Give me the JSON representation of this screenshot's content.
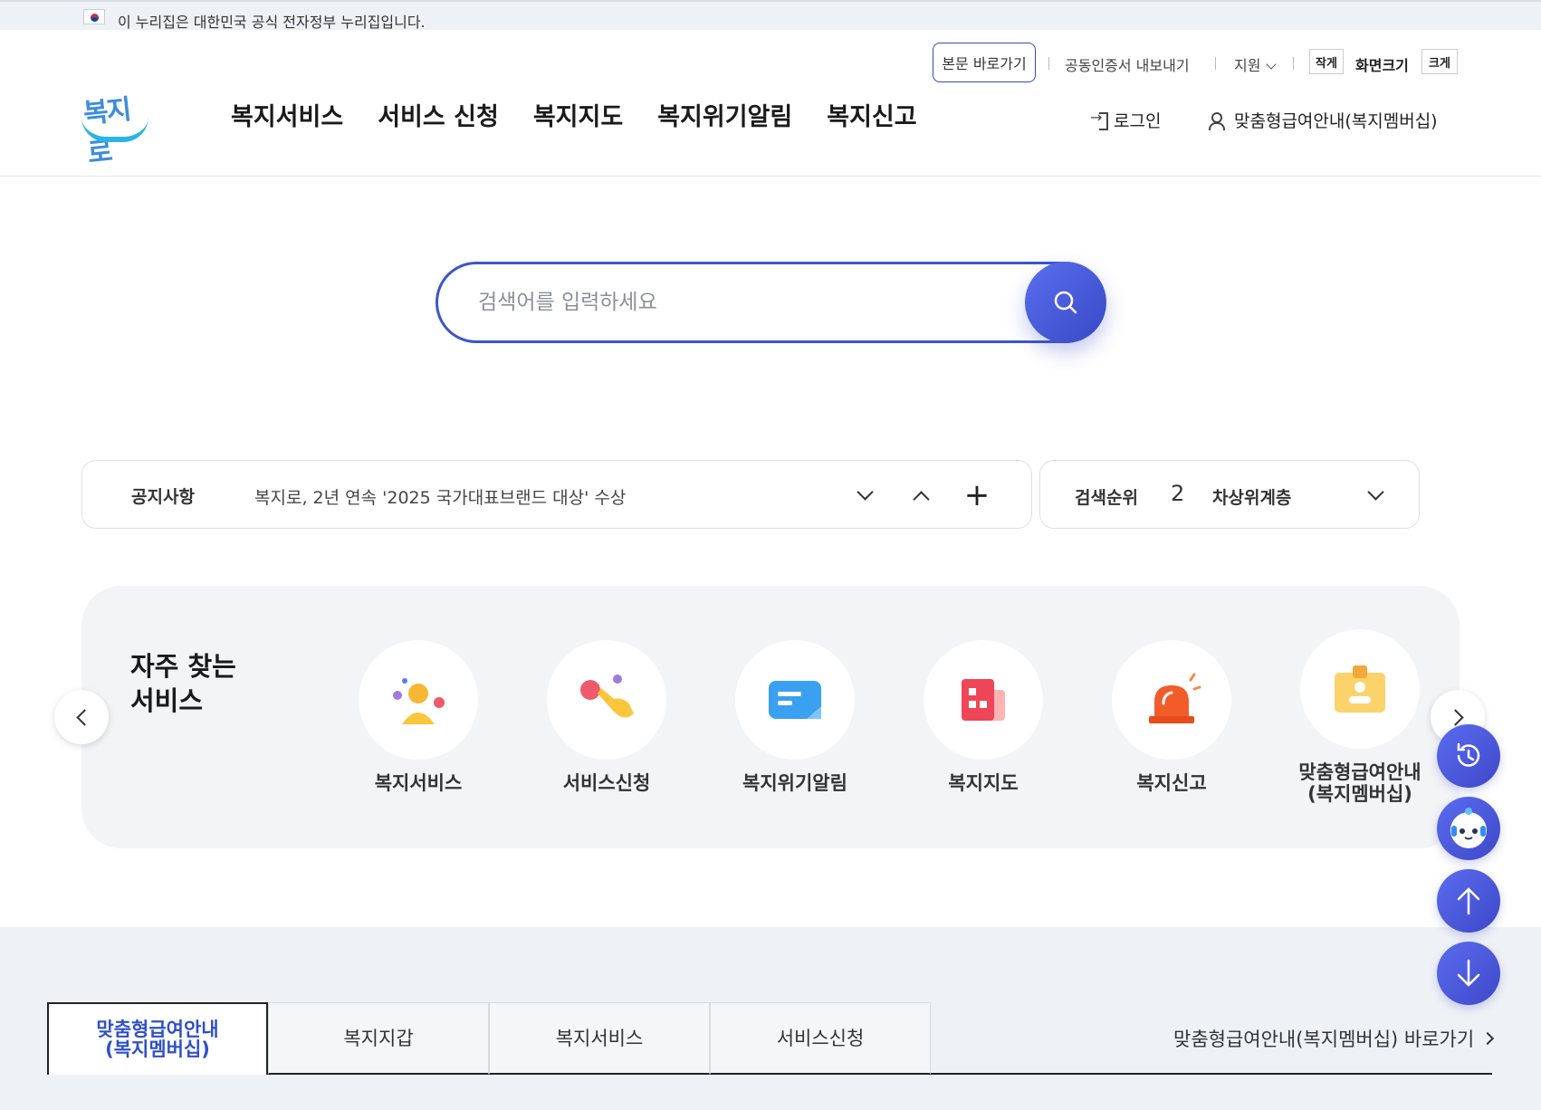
{
  "gov_banner": {
    "text": "이 누리집은 대한민국 공식 전자정부 누리집입니다."
  },
  "utility": {
    "skip_label": "본문 바로가기",
    "cert_label": "공동인증서 내보내기",
    "support_label": "지원",
    "font_small": "작게",
    "font_size_label": "화면크기",
    "font_big": "크게"
  },
  "logo": {
    "text": "복지로"
  },
  "gnb": [
    "복지서비스",
    "서비스 신청",
    "복지지도",
    "복지위기알림",
    "복지신고"
  ],
  "auth": {
    "login": "로그인",
    "membership": "맞춤형급여안내(복지멤버십)"
  },
  "search": {
    "placeholder": "검색어를 입력하세요"
  },
  "notice": {
    "label": "공지사항",
    "text": "복지로, 2년 연속 '2025 국가대표브랜드 대상' 수상"
  },
  "rank": {
    "label": "검색순위",
    "number": "2",
    "term": "차상위계층"
  },
  "frequent": {
    "title_line1": "자주 찾는",
    "title_line2": "서비스",
    "items": [
      {
        "label": "복지서비스",
        "icon": "person-dots-icon"
      },
      {
        "label": "서비스신청",
        "icon": "hand-tap-icon"
      },
      {
        "label": "복지위기알림",
        "icon": "chat-card-icon"
      },
      {
        "label": "복지지도",
        "icon": "map-building-icon"
      },
      {
        "label": "복지신고",
        "icon": "siren-icon"
      },
      {
        "label_line1": "맞춤형급여안내",
        "label_line2": "(복지멤버십)",
        "icon": "membership-card-icon"
      }
    ]
  },
  "tabs": [
    {
      "label_line1": "맞춤형급여안내",
      "label_line2": "(복지멤버십)",
      "active": true
    },
    {
      "label": "복지지갑"
    },
    {
      "label": "복지서비스"
    },
    {
      "label": "서비스신청"
    }
  ],
  "shortcut": {
    "label": "맞춤형급여안내(복지멤버십) 바로가기"
  },
  "colors": {
    "primary": "#3b55c9",
    "accent_tab": "#2f50c8",
    "fab": "#4f5ee0",
    "panel_bg": "#f3f4f6"
  }
}
